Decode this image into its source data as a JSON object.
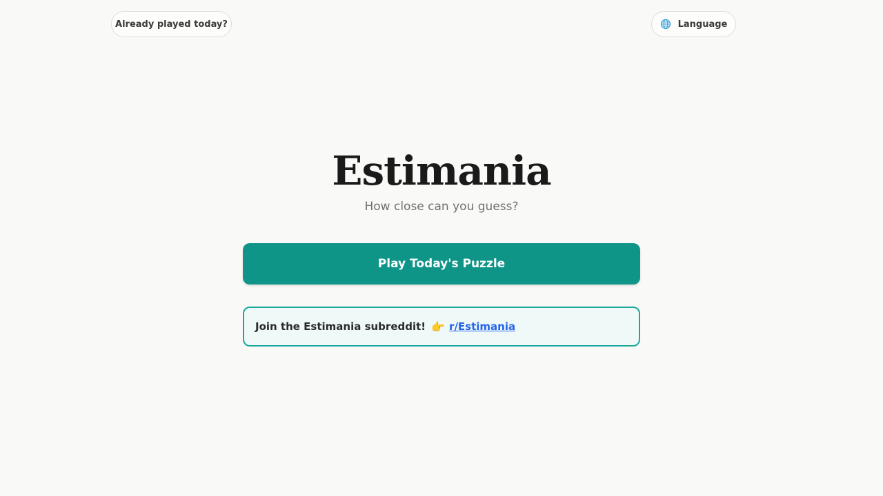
{
  "header": {
    "already_played_label": "Already played today?",
    "language_label": "Language",
    "language_icon": "globe-icon"
  },
  "hero": {
    "title": "Estimania",
    "subtitle": "How close can you guess?"
  },
  "play_button_label": "Play Today's Puzzle",
  "subreddit_banner": {
    "text": "Join the Estimania subreddit!",
    "pointer_icon": "👉",
    "link_text": "r/Estimania"
  },
  "colors": {
    "background": "#f9f9f7",
    "accent": "#0f9588",
    "banner_border": "#1aa89d",
    "banner_background": "#effaf8",
    "link": "#2563eb"
  }
}
